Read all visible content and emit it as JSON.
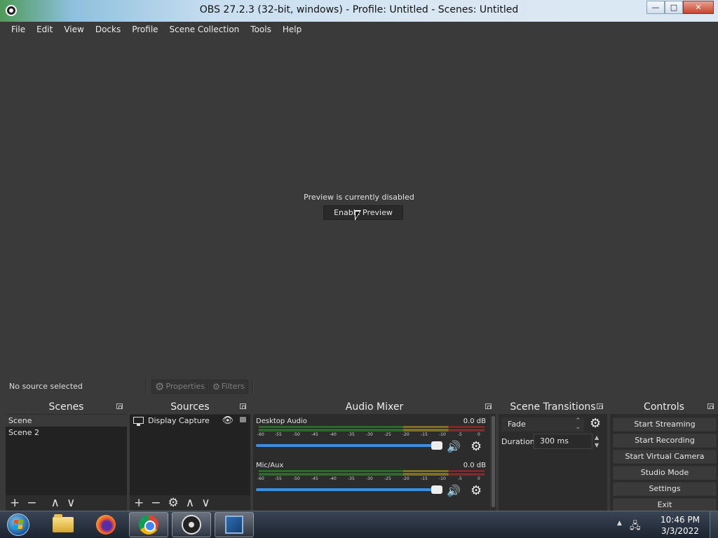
{
  "window": {
    "title": "OBS 27.2.3 (32-bit, windows) - Profile: Untitled - Scenes: Untitled",
    "controls": [
      "minimize",
      "maximize",
      "close"
    ]
  },
  "menu": [
    "File",
    "Edit",
    "View",
    "Docks",
    "Profile",
    "Scene Collection",
    "Tools",
    "Help"
  ],
  "preview": {
    "message": "Preview is currently disabled",
    "enable_label": "Enable Preview"
  },
  "source_toolbar": {
    "status": "No source selected",
    "properties_label": "Properties",
    "filters_label": "Filters"
  },
  "scenes": {
    "title": "Scenes",
    "items": [
      {
        "label": "Scene",
        "selected": true
      },
      {
        "label": "Scene 2",
        "selected": false
      }
    ],
    "footer": [
      "+",
      "−",
      "∧",
      "∨"
    ]
  },
  "sources": {
    "title": "Sources",
    "items": [
      {
        "label": "Display Capture",
        "icon": "monitor-icon",
        "visible": true,
        "locked": false
      }
    ],
    "footer": [
      "+",
      "−",
      "gear",
      "∧",
      "∨"
    ]
  },
  "mixer": {
    "title": "Audio Mixer",
    "ticks": [
      "-60",
      "-55",
      "-50",
      "-45",
      "-40",
      "-35",
      "-30",
      "-25",
      "-20",
      "-15",
      "-10",
      "-5",
      "0"
    ],
    "channels": [
      {
        "name": "Desktop Audio",
        "db": "0.0 dB",
        "volume": 0.95
      },
      {
        "name": "Mic/Aux",
        "db": "0.0 dB",
        "volume": 0.95
      }
    ]
  },
  "transitions": {
    "title": "Scene Transitions",
    "selected": "Fade",
    "duration_label": "Duration",
    "duration_value": "300 ms"
  },
  "controls": {
    "title": "Controls",
    "buttons": [
      "Start Streaming",
      "Start Recording",
      "Start Virtual Camera",
      "Studio Mode",
      "Settings",
      "Exit"
    ]
  },
  "taskbar": {
    "apps": [
      "folder-icon",
      "firefox-icon",
      "chrome-icon",
      "obs-icon",
      "virtualbox-icon"
    ],
    "time": "10:46 PM",
    "date": "3/3/2022"
  }
}
